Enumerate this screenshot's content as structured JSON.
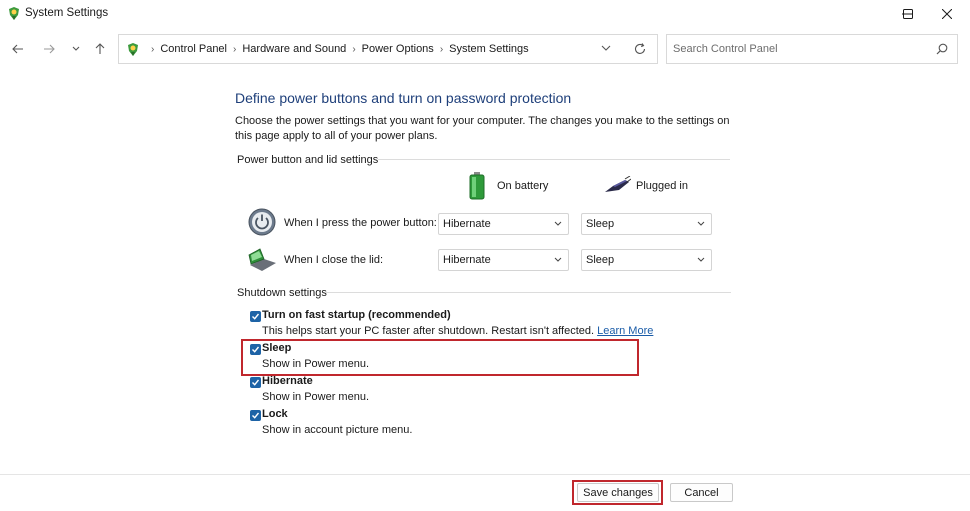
{
  "window": {
    "title": "System Settings"
  },
  "nav": {
    "breadcrumbs": [
      "Control Panel",
      "Hardware and Sound",
      "Power Options",
      "System Settings"
    ],
    "search_placeholder": "Search Control Panel"
  },
  "page": {
    "heading": "Define power buttons and turn on password protection",
    "description": "Choose the power settings that you want for your computer. The changes you make to the settings on this page apply to all of your power plans."
  },
  "power_group": {
    "title": "Power button and lid settings",
    "col_battery": "On battery",
    "col_plugged": "Plugged in",
    "rows": [
      {
        "label": "When I press the power button:",
        "icon": "power-button-icon",
        "battery": "Hibernate",
        "plugged": "Sleep"
      },
      {
        "label": "When I close the lid:",
        "icon": "laptop-lid-icon",
        "battery": "Hibernate",
        "plugged": "Sleep"
      }
    ]
  },
  "shutdown_group": {
    "title": "Shutdown settings",
    "items": [
      {
        "label": "Turn on fast startup (recommended)",
        "desc": "This helps start your PC faster after shutdown. Restart isn't affected.",
        "link": "Learn More",
        "checked": true
      },
      {
        "label": "Sleep",
        "desc": "Show in Power menu.",
        "checked": true
      },
      {
        "label": "Hibernate",
        "desc": "Show in Power menu.",
        "checked": true
      },
      {
        "label": "Lock",
        "desc": "Show in account picture menu.",
        "checked": true
      }
    ]
  },
  "footer": {
    "save": "Save changes",
    "cancel": "Cancel"
  },
  "colors": {
    "accent": "#1d63a6",
    "heading": "#1e3f7a",
    "highlight": "#c0272d",
    "link": "#1a5ca8"
  }
}
